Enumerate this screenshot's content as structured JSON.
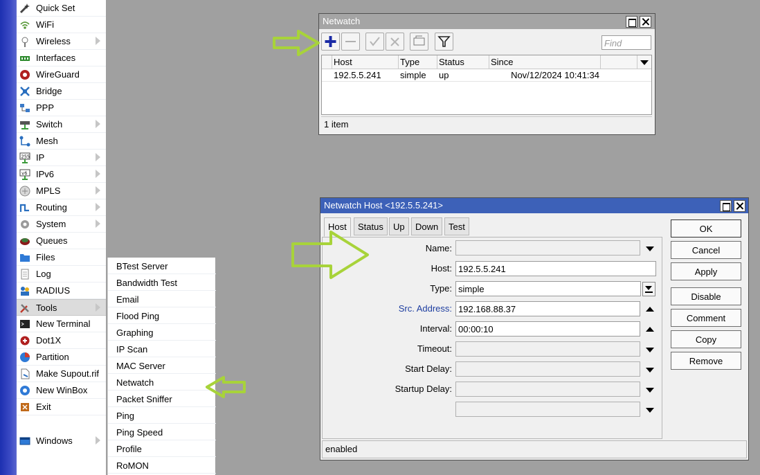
{
  "menu": {
    "items": [
      {
        "label": "Quick Set",
        "icon": "wand-icon"
      },
      {
        "label": "WiFi",
        "icon": "wifi-icon"
      },
      {
        "label": "Wireless",
        "icon": "antenna-icon",
        "sub": true
      },
      {
        "label": "Interfaces",
        "icon": "interfaces-icon"
      },
      {
        "label": "WireGuard",
        "icon": "wireguard-icon"
      },
      {
        "label": "Bridge",
        "icon": "bridge-icon"
      },
      {
        "label": "PPP",
        "icon": "ppp-icon"
      },
      {
        "label": "Switch",
        "icon": "switch-icon",
        "sub": true
      },
      {
        "label": "Mesh",
        "icon": "mesh-icon"
      },
      {
        "label": "IP",
        "icon": "ip-icon",
        "sub": true
      },
      {
        "label": "IPv6",
        "icon": "ipv6-icon",
        "sub": true
      },
      {
        "label": "MPLS",
        "icon": "mpls-icon",
        "sub": true
      },
      {
        "label": "Routing",
        "icon": "routing-icon",
        "sub": true
      },
      {
        "label": "System",
        "icon": "gear-icon",
        "sub": true
      },
      {
        "label": "Queues",
        "icon": "queues-icon"
      },
      {
        "label": "Files",
        "icon": "folder-icon"
      },
      {
        "label": "Log",
        "icon": "log-icon"
      },
      {
        "label": "RADIUS",
        "icon": "radius-icon"
      },
      {
        "label": "Tools",
        "icon": "tools-icon",
        "sub": true,
        "selected": true
      },
      {
        "label": "New Terminal",
        "icon": "terminal-icon"
      },
      {
        "label": "Dot1X",
        "icon": "dot1x-icon"
      },
      {
        "label": "Partition",
        "icon": "partition-icon"
      },
      {
        "label": "Make Supout.rif",
        "icon": "supout-icon"
      },
      {
        "label": "New WinBox",
        "icon": "winbox-icon"
      },
      {
        "label": "Exit",
        "icon": "exit-icon"
      }
    ],
    "windows_label": "Windows"
  },
  "tools_submenu": [
    "BTest Server",
    "Bandwidth Test",
    "Email",
    "Flood Ping",
    "Graphing",
    "IP Scan",
    "MAC Server",
    "Netwatch",
    "Packet Sniffer",
    "Ping",
    "Ping Speed",
    "Profile",
    "RoMON"
  ],
  "netwatch": {
    "title": "Netwatch",
    "find_placeholder": "Find",
    "columns": [
      "Host",
      "Type",
      "Status",
      "Since"
    ],
    "rows": [
      {
        "host": "192.5.5.241",
        "type": "simple",
        "status": "up",
        "since": "Nov/12/2024 10:41:34"
      }
    ],
    "status": "1 item"
  },
  "host_dialog": {
    "title": "Netwatch Host <192.5.5.241>",
    "tabs": [
      "Host",
      "Status",
      "Up",
      "Down",
      "Test"
    ],
    "fields": {
      "name_label": "Name:",
      "name_value": "",
      "host_label": "Host:",
      "host_value": "192.5.5.241",
      "type_label": "Type:",
      "type_value": "simple",
      "src_label": "Src. Address:",
      "src_value": "192.168.88.37",
      "interval_label": "Interval:",
      "interval_value": "00:00:10",
      "timeout_label": "Timeout:",
      "start_delay_label": "Start Delay:",
      "startup_delay_label": "Startup Delay:"
    },
    "buttons": {
      "ok": "OK",
      "cancel": "Cancel",
      "apply": "Apply",
      "disable": "Disable",
      "comment": "Comment",
      "copy": "Copy",
      "remove": "Remove"
    },
    "status": "enabled"
  },
  "colors": {
    "title_bar": "#3d61b8",
    "accent_arrow": "#a8d33a",
    "src_label": "#1e3ea0"
  }
}
